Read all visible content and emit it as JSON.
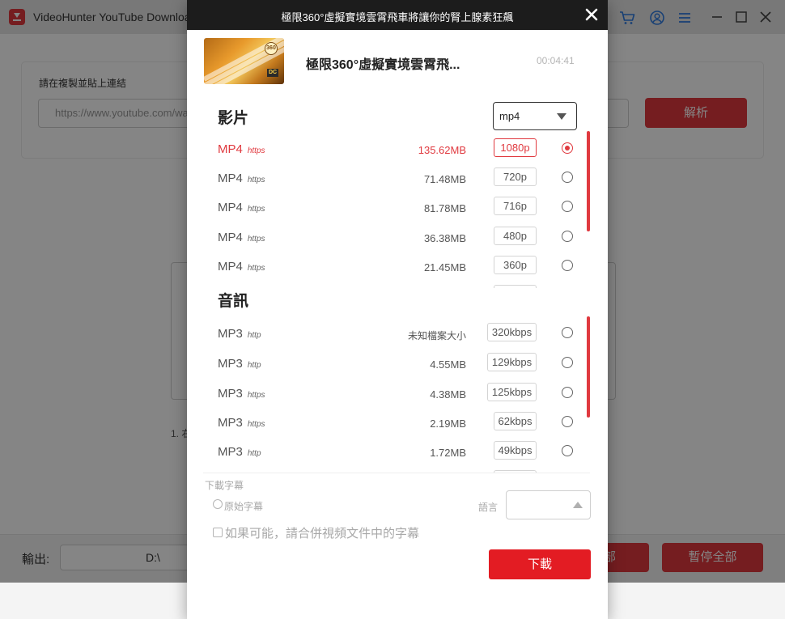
{
  "app": {
    "title": "VideoHunter YouTube Downloader",
    "url_label": "請在複製並貼上連結",
    "url_placeholder": "https://www.youtube.com/watch?v=...",
    "analyze_label": "解析",
    "hint_text": "1. 右",
    "output_label": "輸出:",
    "output_path": "D:\\",
    "download_all_label": "全部",
    "pause_all_label": "暫停全部"
  },
  "modal": {
    "title": "極限360°虛擬實境雲霄飛車將讓你的腎上腺素狂飆",
    "video_name": "極限360°虛擬實境雲霄飛...",
    "duration": "00:04:41",
    "thumbnail_badge": "360",
    "thumbnail_tag": "DC",
    "video_section": "影片",
    "audio_section": "音訊",
    "format_selected": "mp4",
    "video_items": [
      {
        "format": "MP4",
        "protocol": "https",
        "size": "135.62MB",
        "quality": "1080p",
        "selected": true
      },
      {
        "format": "MP4",
        "protocol": "https",
        "size": "71.48MB",
        "quality": "720p",
        "selected": false
      },
      {
        "format": "MP4",
        "protocol": "https",
        "size": "81.78MB",
        "quality": "716p",
        "selected": false
      },
      {
        "format": "MP4",
        "protocol": "https",
        "size": "36.38MB",
        "quality": "480p",
        "selected": false
      },
      {
        "format": "MP4",
        "protocol": "https",
        "size": "21.45MB",
        "quality": "360p",
        "selected": false
      }
    ],
    "audio_items": [
      {
        "format": "MP3",
        "protocol": "http",
        "size": "未知檔案大小",
        "quality": "320kbps",
        "selected": false
      },
      {
        "format": "MP3",
        "protocol": "http",
        "size": "4.55MB",
        "quality": "129kbps",
        "selected": false
      },
      {
        "format": "MP3",
        "protocol": "https",
        "size": "4.38MB",
        "quality": "125kbps",
        "selected": false
      },
      {
        "format": "MP3",
        "protocol": "https",
        "size": "2.19MB",
        "quality": "62kbps",
        "selected": false
      },
      {
        "format": "MP3",
        "protocol": "http",
        "size": "1.72MB",
        "quality": "49kbps",
        "selected": false
      }
    ],
    "subtitle_heading": "下載字幕",
    "subtitle_original": "原始字幕",
    "language_label": "語言",
    "merge_label": "如果可能，請合併視頻文件中的字幕",
    "download_label": "下載"
  },
  "colors": {
    "accent": "#e31c23",
    "header": "#1c1c1c",
    "link_blue": "#2f7be0"
  },
  "icons": [
    "close-icon",
    "cart-icon",
    "account-icon",
    "menu-icon",
    "minimize-icon",
    "maximize-icon",
    "close-window-icon",
    "dropdown-caret-icon"
  ]
}
